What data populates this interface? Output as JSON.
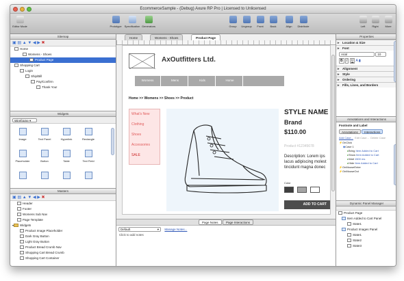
{
  "window": {
    "title": "EcommerceSample - (Debug) Axure RP Pro | Licensed to Unlicensed"
  },
  "toolbar": {
    "left": [
      {
        "label": "Editor Mode"
      }
    ],
    "mid": [
      {
        "label": "Prototype"
      },
      {
        "label": "Specification"
      },
      {
        "label": "Generators"
      }
    ],
    "right": [
      {
        "label": "Group"
      },
      {
        "label": "Ungroup"
      },
      {
        "label": "Front"
      },
      {
        "label": "Back"
      },
      {
        "label": "Align"
      },
      {
        "label": "Distribute"
      }
    ],
    "far": [
      {
        "label": "Left"
      },
      {
        "label": "Right"
      },
      {
        "label": "More"
      }
    ]
  },
  "sitemap": {
    "title": "Sitemap",
    "items": [
      {
        "label": "Home",
        "indent": 1
      },
      {
        "label": "Womens - Shoes",
        "indent": 2
      },
      {
        "label": "Product Page",
        "indent": 3,
        "selected": true
      },
      {
        "label": "Shopping Cart",
        "indent": 1
      },
      {
        "label": "Login",
        "indent": 2
      },
      {
        "label": "Ship/Bill",
        "indent": 3
      },
      {
        "label": "Pay/Confirm",
        "indent": 4
      },
      {
        "label": "Thank You!",
        "indent": 5
      }
    ]
  },
  "widgets": {
    "title": "Widgets",
    "library": "Wireframe",
    "items": [
      {
        "label": "Image"
      },
      {
        "label": "Text Panel"
      },
      {
        "label": "Hyperlink"
      },
      {
        "label": "Rectangle"
      },
      {
        "label": "Placeholder"
      },
      {
        "label": "Button"
      },
      {
        "label": "Table"
      },
      {
        "label": "Text Field"
      }
    ]
  },
  "masters": {
    "title": "Masters",
    "items": [
      {
        "label": "Header",
        "type": "page"
      },
      {
        "label": "Footer",
        "type": "page"
      },
      {
        "label": "Womens Sub Nav",
        "type": "page"
      },
      {
        "label": "Page Template",
        "type": "page"
      },
      {
        "label": "Widgets",
        "type": "folder"
      },
      {
        "label": "Product Image Placeholder",
        "type": "page"
      },
      {
        "label": "Dark Gray Button",
        "type": "page"
      },
      {
        "label": "Light Gray Button",
        "type": "page"
      },
      {
        "label": "Product Bread Crumb Nav",
        "type": "page"
      },
      {
        "label": "Shopping Cart Bread Crumb",
        "type": "page"
      },
      {
        "label": "Shopping Cart Container",
        "type": "page"
      }
    ]
  },
  "tabs": [
    {
      "label": "Home"
    },
    {
      "label": "Womens - Shoes"
    },
    {
      "label": "Product Page",
      "active": true
    }
  ],
  "page": {
    "brand": "AxOutfitters Ltd.",
    "nav": [
      "Womens",
      "Mens",
      "Kids",
      "Home"
    ],
    "breadcrumb": "Home >> Womens >> Shoes >> Product",
    "side_nav": [
      "What's New",
      "Clothing",
      "Shoes",
      "Accessories",
      "SALE"
    ],
    "style_name": "STYLE NAME",
    "brand_label": "Brand",
    "price": "$110.00",
    "product_id": "Product #12345678",
    "description": "Description: Lorem ips lacus adipiscing molest tincidunt magna donec",
    "color_label": "Color",
    "add_to_cart": "ADD TO CART",
    "swatch_colors": [
      "#3f3f3f",
      "#a5a5a5",
      "#ffffff"
    ]
  },
  "notes": {
    "tabs": [
      {
        "label": "Page Notes",
        "active": true
      },
      {
        "label": "Page Interactions"
      }
    ],
    "select": "Default",
    "manage": "Manage Notes...",
    "placeholder": "Click to add notes"
  },
  "properties": {
    "title": "Properties",
    "sections": [
      "Location & Size",
      "Font"
    ],
    "font_name": "Arial",
    "font_size": "10",
    "more_sections": [
      "Alignment",
      "Style",
      "Ordering",
      "Fills, Lines, and Borders"
    ]
  },
  "annotations": {
    "title": "Annotations and Interactions",
    "footnote": "Footnote and Label",
    "tabs": [
      {
        "label": "Annotations"
      },
      {
        "label": "Interactions",
        "active": true
      }
    ],
    "actions": [
      "Add Case...",
      "Edit Case...",
      "Delete Case"
    ],
    "events": [
      {
        "text": "OnClick",
        "indent": 0
      },
      {
        "text": "Case 1",
        "indent": 1
      },
      {
        "prefix": "Bring ",
        "text": "Item Added to Cart",
        "indent": 2
      },
      {
        "prefix": "Show ",
        "text": "Item Added to Cart",
        "indent": 2
      },
      {
        "prefix": "Wait ",
        "text": "1500 ms",
        "indent": 2
      },
      {
        "prefix": "Hide ",
        "text": "Item Added to Cart",
        "indent": 2
      },
      {
        "text": "OnMouseEnter",
        "indent": 0
      },
      {
        "text": "OnMouseOut",
        "indent": 0
      }
    ]
  },
  "dynamic_panels": {
    "title": "Dynamic Panel Manager",
    "items": [
      {
        "label": "Product Page",
        "indent": 0
      },
      {
        "label": "Item Added to Cart Panel",
        "indent": 1
      },
      {
        "label": "State1",
        "indent": 2
      },
      {
        "label": "Product Images Panel",
        "indent": 1
      },
      {
        "label": "State1",
        "indent": 2
      },
      {
        "label": "State2",
        "indent": 2
      },
      {
        "label": "State3",
        "indent": 2
      }
    ]
  }
}
